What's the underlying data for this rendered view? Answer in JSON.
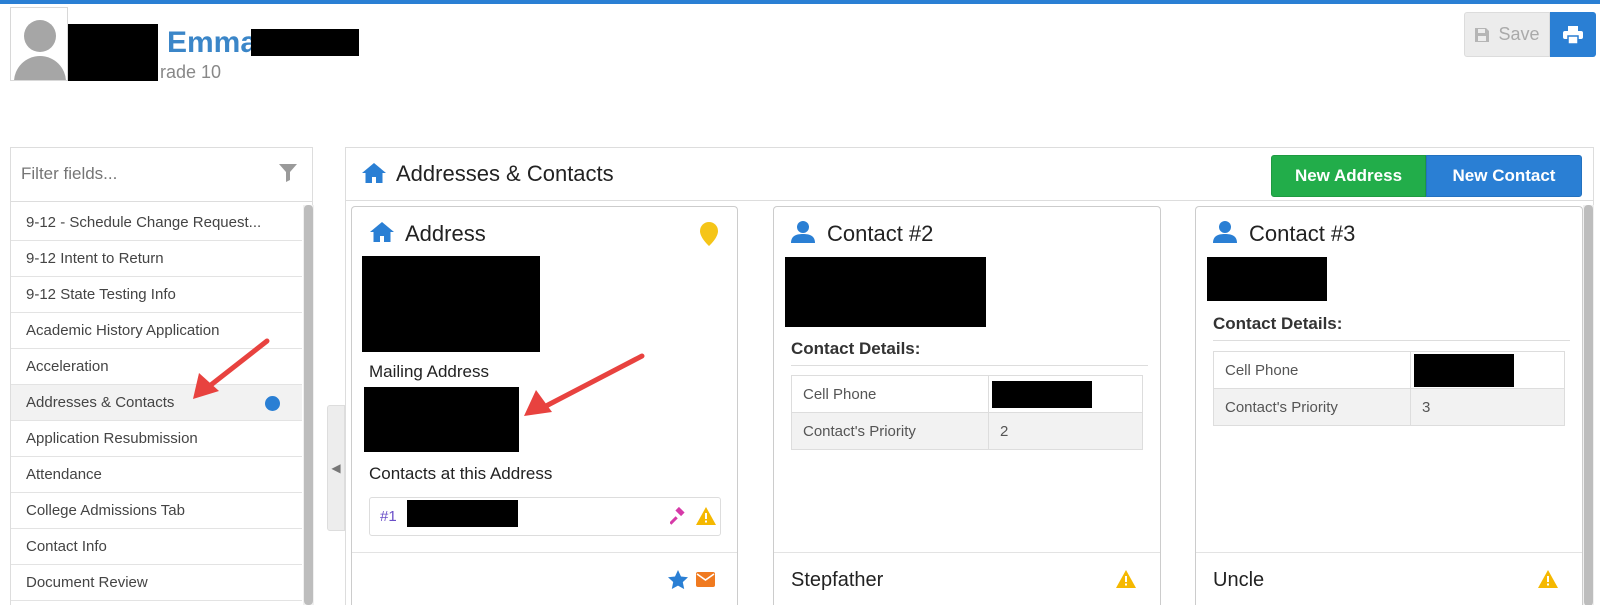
{
  "header": {
    "student_first_name": "Emma",
    "grade_text": "rade 10",
    "save_label": "Save"
  },
  "sidebar": {
    "filter_placeholder": "Filter fields...",
    "items": [
      {
        "label": "9-12 - Schedule Change Request..."
      },
      {
        "label": "9-12 Intent to Return"
      },
      {
        "label": "9-12 State Testing Info"
      },
      {
        "label": "Academic History Application"
      },
      {
        "label": "Acceleration"
      },
      {
        "label": "Addresses & Contacts"
      },
      {
        "label": "Application Resubmission"
      },
      {
        "label": "Attendance"
      },
      {
        "label": "College Admissions Tab"
      },
      {
        "label": "Contact Info"
      },
      {
        "label": "Document Review"
      }
    ],
    "active_index": 5
  },
  "panel": {
    "title": "Addresses & Contacts",
    "new_address_label": "New Address",
    "new_contact_label": "New Contact"
  },
  "cards": {
    "address": {
      "title": "Address",
      "mailing_label": "Mailing Address",
      "contacts_label": "Contacts at this Address",
      "contact_number": "#1"
    },
    "contact2": {
      "title": "Contact #2",
      "details_label": "Contact Details:",
      "rows": [
        {
          "label": "Cell Phone",
          "value": ""
        },
        {
          "label": "Contact's Priority",
          "value": "2"
        }
      ],
      "relationship": "Stepfather"
    },
    "contact3": {
      "title": "Contact #3",
      "details_label": "Contact Details:",
      "rows": [
        {
          "label": "Cell Phone",
          "value": ""
        },
        {
          "label": "Contact's Priority",
          "value": "3"
        }
      ],
      "relationship": "Uncle"
    }
  },
  "colors": {
    "brand_blue": "#2a7fd4",
    "success_green": "#22ad4a",
    "warning_yellow": "#f5b800",
    "annotation_red": "#e8423f"
  },
  "icons": [
    "home-icon",
    "user-icon",
    "map-pin-icon",
    "star-icon",
    "envelope-icon",
    "warning-icon",
    "gavel-icon",
    "filter-icon",
    "save-icon",
    "print-icon"
  ]
}
